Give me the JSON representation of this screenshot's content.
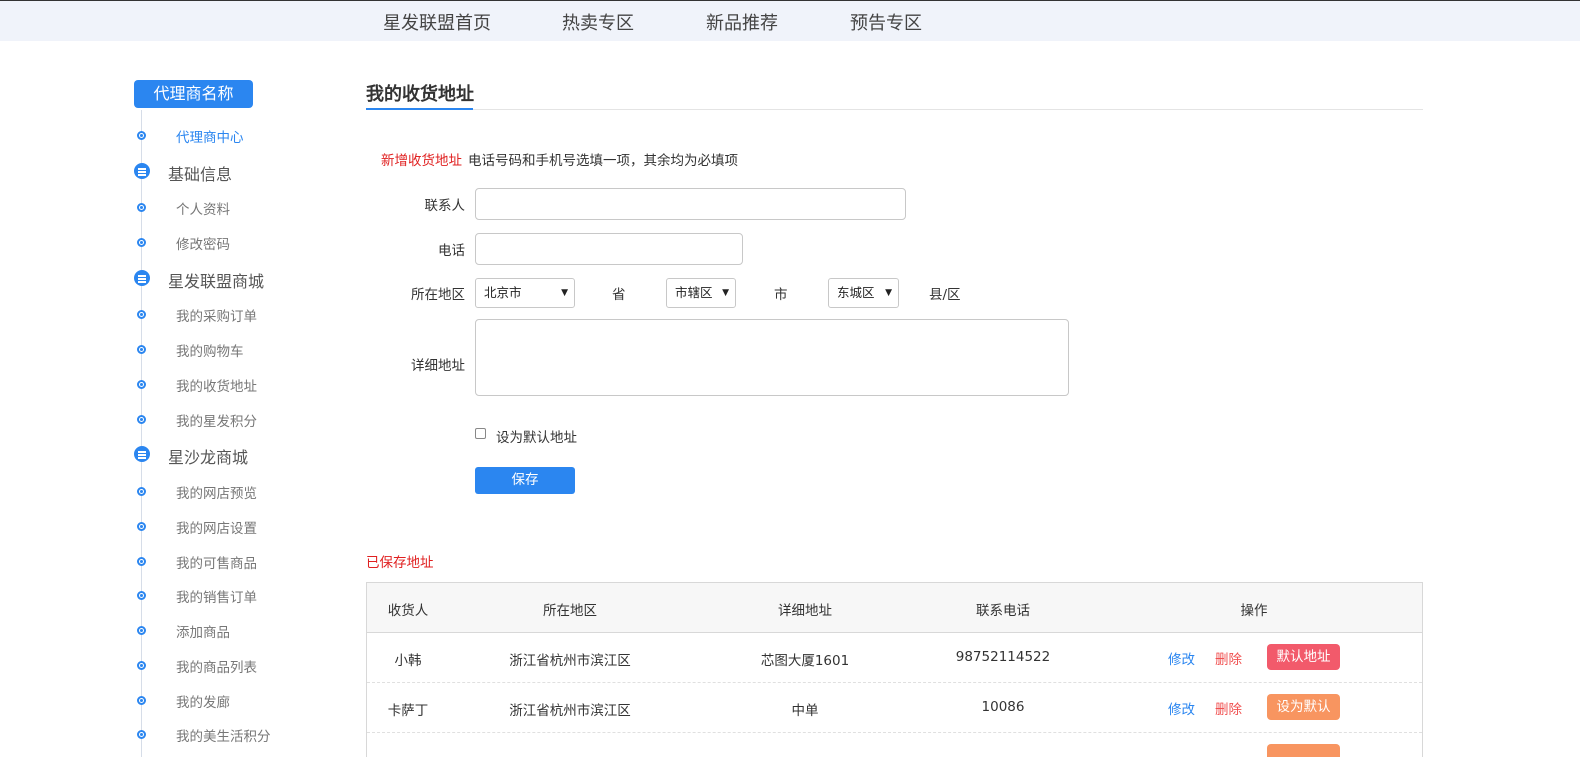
{
  "topnav": {
    "items": [
      "星发联盟首页",
      "热卖专区",
      "新品推荐",
      "预告专区"
    ]
  },
  "sidebar": {
    "title": "代理商名称",
    "center": "代理商中心",
    "groups": [
      {
        "name": "基础信息",
        "items": [
          "个人资料",
          "修改密码"
        ]
      },
      {
        "name": "星发联盟商城",
        "items": [
          "我的采购订单",
          "我的购物车",
          "我的收货地址",
          "我的星发积分"
        ]
      },
      {
        "name": "星沙龙商城",
        "items": [
          "我的网店预览",
          "我的网店设置",
          "我的可售商品",
          "我的销售订单",
          "添加商品",
          "我的商品列表",
          "我的发廊",
          "我的美生活积分"
        ]
      }
    ]
  },
  "main": {
    "title": "我的收货地址",
    "form": {
      "heading": "新增收货地址",
      "note": "电话号码和手机号选填一项，其余均为必填项",
      "contact_label": "联系人",
      "phone_label": "电话",
      "region_label": "所在地区",
      "province_value": "北京市",
      "province_unit": "省",
      "city_value": "市辖区",
      "city_unit": "市",
      "district_value": "东城区",
      "district_unit": "县/区",
      "detail_label": "详细地址",
      "default_checkbox_label": "设为默认地址",
      "save_label": "保存"
    },
    "saved": {
      "title": "已保存地址",
      "headers": [
        "收货人",
        "所在地区",
        "详细地址",
        "联系电话",
        "操作"
      ],
      "rows": [
        {
          "name": "小韩",
          "region": "浙江省杭州市滨江区",
          "detail": "芯图大厦1601",
          "phone": "98752114522",
          "edit": "修改",
          "delete": "删除",
          "tag": "默认地址"
        },
        {
          "name": "卡萨丁",
          "region": "浙江省杭州市滨江区",
          "detail": "中单",
          "phone": "10086",
          "edit": "修改",
          "delete": "删除",
          "tag": "设为默认"
        }
      ]
    }
  },
  "colors": {
    "accent": "#2b86f0",
    "danger": "#e02020",
    "tag_default": "#f25a6b",
    "tag_set_default": "#f89560"
  }
}
